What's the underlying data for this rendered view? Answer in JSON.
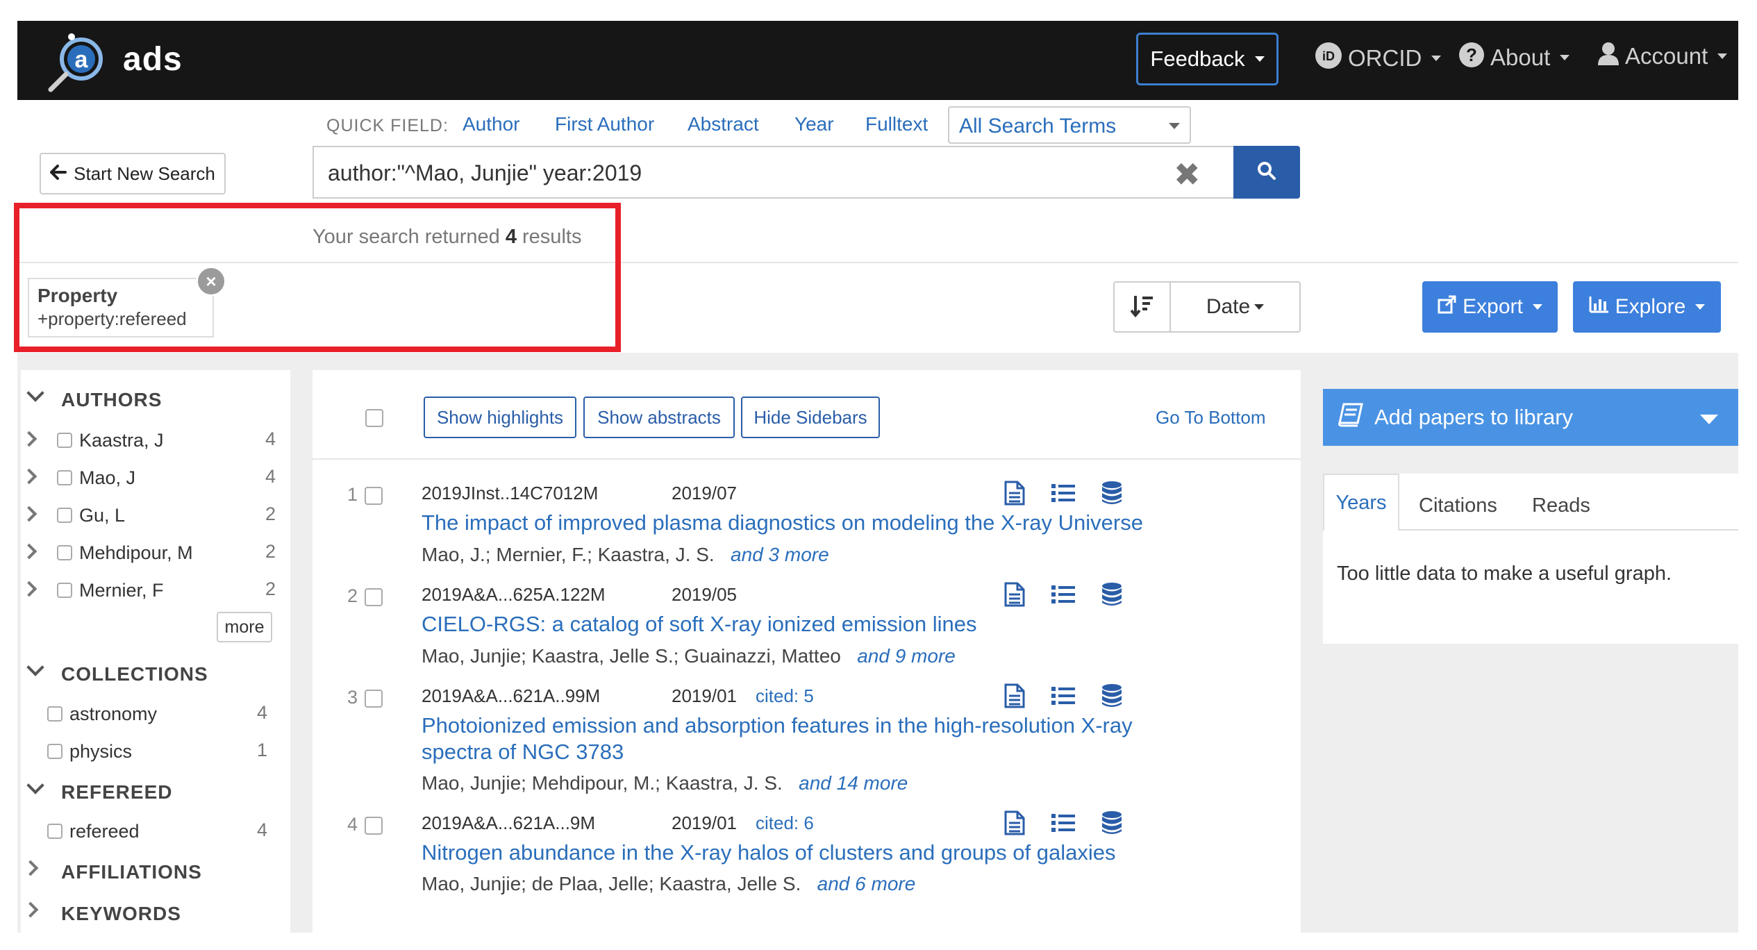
{
  "navbar": {
    "logo_text": "ads",
    "feedback_label": "Feedback",
    "orcid_label": "ORCID",
    "about_label": "About",
    "account_label": "Account"
  },
  "quick_field": {
    "label": "QUICK FIELD:",
    "links": [
      "Author",
      "First Author",
      "Abstract",
      "Year",
      "Fulltext"
    ],
    "select_value": "All Search Terms"
  },
  "search": {
    "new_search_label": "Start New Search",
    "query": "author:\"^Mao, Junjie\" year:2019"
  },
  "results_summary": {
    "prefix": "Your search returned ",
    "count": "4",
    "suffix": " results"
  },
  "filter_chip": {
    "title": "Property",
    "value": "+property:refereed"
  },
  "sort": {
    "field": "Date"
  },
  "actions": {
    "export_label": "Export",
    "explore_label": "Explore"
  },
  "facets": {
    "authors": {
      "heading": "AUTHORS",
      "items": [
        {
          "label": "Kaastra, J",
          "count": "4"
        },
        {
          "label": "Mao, J",
          "count": "4"
        },
        {
          "label": "Gu, L",
          "count": "2"
        },
        {
          "label": "Mehdipour, M",
          "count": "2"
        },
        {
          "label": "Mernier, F",
          "count": "2"
        }
      ],
      "more_label": "more"
    },
    "collections": {
      "heading": "COLLECTIONS",
      "items": [
        {
          "label": "astronomy",
          "count": "4"
        },
        {
          "label": "physics",
          "count": "1"
        }
      ]
    },
    "refereed": {
      "heading": "REFEREED",
      "items": [
        {
          "label": "refereed",
          "count": "4"
        }
      ]
    },
    "affiliations": {
      "heading": "AFFILIATIONS"
    },
    "keywords": {
      "heading": "KEYWORDS"
    }
  },
  "toolbar": {
    "show_highlights": "Show highlights",
    "show_abstracts": "Show abstracts",
    "hide_sidebars": "Hide Sidebars",
    "go_to_bottom": "Go To Bottom"
  },
  "results": [
    {
      "index": "1",
      "bibcode": "2019JInst..14C7012M",
      "date": "2019/07",
      "cited": "",
      "title_lines": [
        "The impact of improved plasma diagnostics on modeling the X-ray Universe"
      ],
      "authors": "Mao, J.;  Mernier, F.;  Kaastra, J. S.",
      "more": "and 3 more"
    },
    {
      "index": "2",
      "bibcode": "2019A&A...625A.122M",
      "date": "2019/05",
      "cited": "",
      "title_lines": [
        "CIELO-RGS: a catalog of soft X-ray ionized emission lines"
      ],
      "authors": "Mao, Junjie;  Kaastra, Jelle S.;  Guainazzi, Matteo",
      "more": "and 9 more"
    },
    {
      "index": "3",
      "bibcode": "2019A&A...621A..99M",
      "date": "2019/01",
      "cited": "cited: 5",
      "title_lines": [
        "Photoionized emission and absorption features in the high-resolution X-ray",
        "spectra of NGC 3783"
      ],
      "authors": "Mao, Junjie;  Mehdipour, M.;  Kaastra, J. S.",
      "more": "and 14 more"
    },
    {
      "index": "4",
      "bibcode": "2019A&A...621A...9M",
      "date": "2019/01",
      "cited": "cited: 6",
      "title_lines": [
        "Nitrogen abundance in the X-ray halos of clusters and groups of galaxies"
      ],
      "authors": "Mao, Junjie;  de Plaa, Jelle;  Kaastra, Jelle S.",
      "more": "and 6 more"
    }
  ],
  "library": {
    "label": "Add papers to library"
  },
  "graph": {
    "tabs": [
      "Years",
      "Citations",
      "Reads"
    ],
    "active_tab": "Years",
    "message": "Too little data to make a useful graph."
  },
  "colors": {
    "navbar_bg": "#161616",
    "link_blue": "#2a6ebb",
    "button_blue": "#3d7fdc",
    "highlight_red": "#e8202a"
  }
}
